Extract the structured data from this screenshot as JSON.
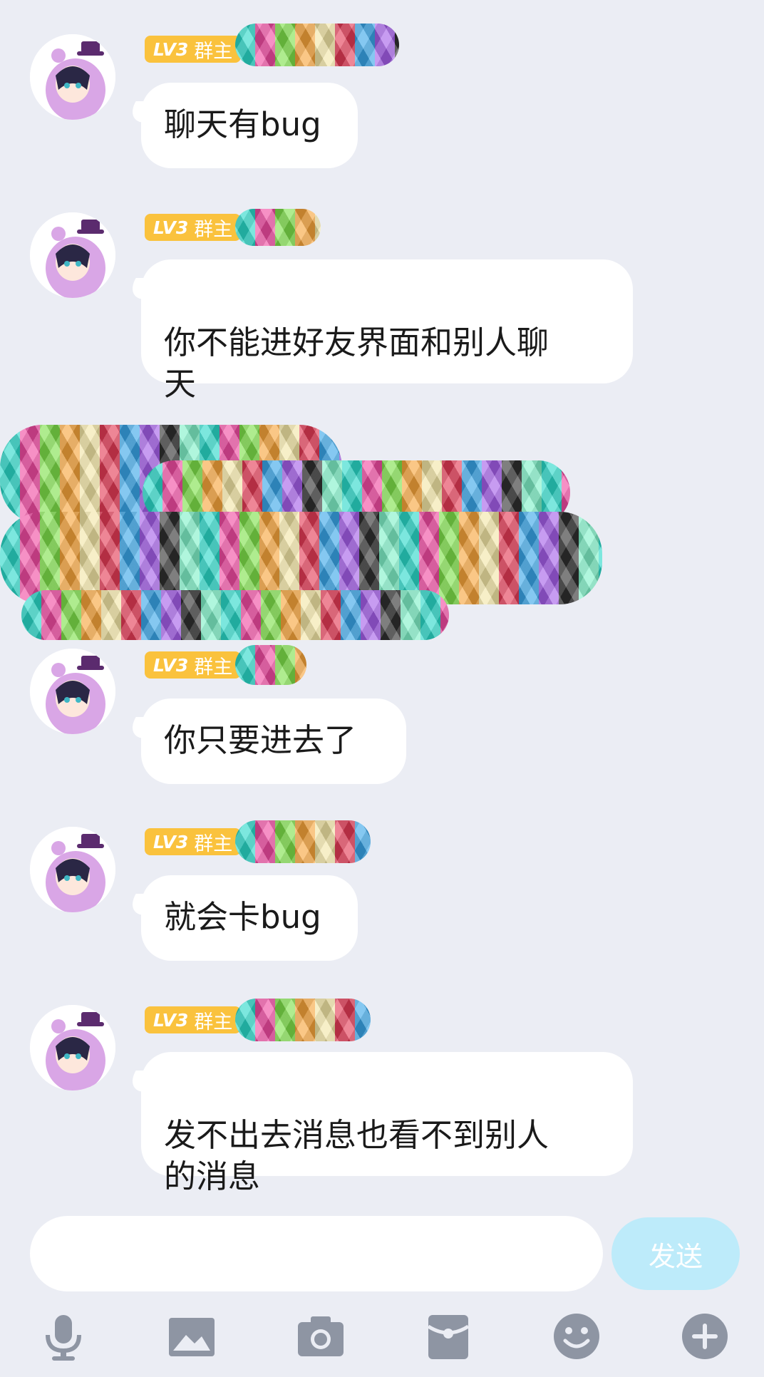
{
  "colors": {
    "background": "#ebedf4",
    "badge": "#fac23d",
    "bubble": "#ffffff",
    "send_button": "#bdebfa",
    "toolbar_icon": "#8e95a3"
  },
  "messages": [
    {
      "level": "LV3",
      "role": "群主",
      "text": "聊天有bug"
    },
    {
      "level": "LV3",
      "role": "群主",
      "text": "你不能进好友界面和别人聊\n天"
    },
    {
      "level": "LV3",
      "role": "群主",
      "text": "你只要进去了"
    },
    {
      "level": "LV3",
      "role": "群主",
      "text": "就会卡bug"
    },
    {
      "level": "LV3",
      "role": "群主",
      "text": "发不出去消息也看不到别人\n的消息"
    }
  ],
  "composer": {
    "input_value": "",
    "send_label": "发送"
  },
  "toolbar": {
    "icons": [
      "microphone-icon",
      "image-icon",
      "camera-icon",
      "red-packet-icon",
      "emoji-icon",
      "plus-icon"
    ]
  }
}
